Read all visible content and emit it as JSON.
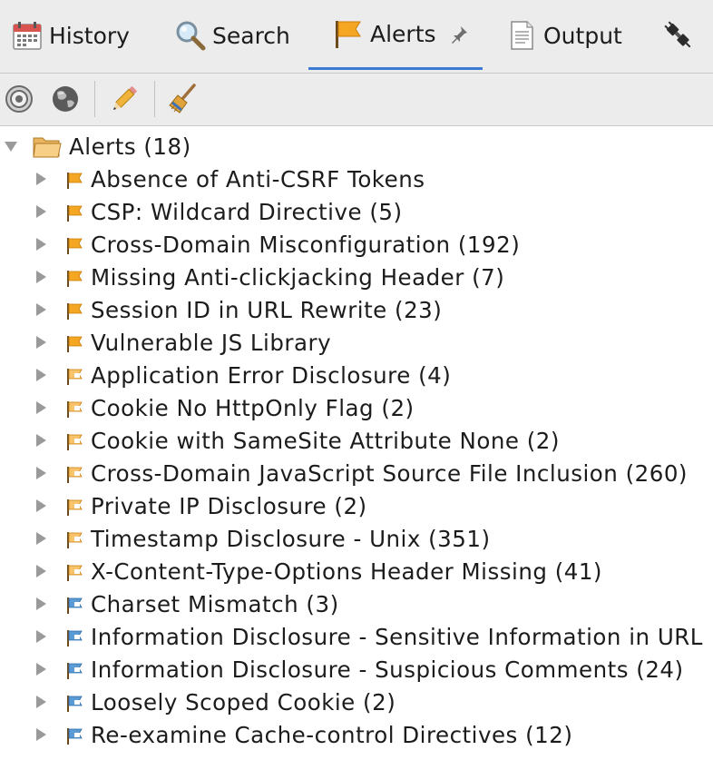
{
  "tabs": [
    {
      "label": "History",
      "icon": "calendar-icon",
      "active": false
    },
    {
      "label": "Search",
      "icon": "magnifier-icon",
      "active": false
    },
    {
      "label": "Alerts",
      "icon": "flag-icon",
      "active": true
    },
    {
      "label": "Output",
      "icon": "document-icon",
      "active": false
    }
  ],
  "extra_tab_icon": "plug-icon",
  "pin_icon": "pin-icon",
  "toolbar_icons": [
    "target-icon",
    "globe-icon",
    "pencil-icon",
    "broom-icon"
  ],
  "tree": {
    "root_label": "Alerts (18)",
    "root_icon": "folder-icon",
    "expanded": true,
    "items": [
      {
        "label": "Absence of Anti-CSRF Tokens",
        "risk": "medium"
      },
      {
        "label": "CSP: Wildcard Directive (5)",
        "risk": "medium"
      },
      {
        "label": "Cross-Domain Misconfiguration (192)",
        "risk": "medium"
      },
      {
        "label": "Missing Anti-clickjacking Header (7)",
        "risk": "medium"
      },
      {
        "label": "Session ID in URL Rewrite (23)",
        "risk": "medium"
      },
      {
        "label": "Vulnerable JS Library",
        "risk": "medium"
      },
      {
        "label": "Application Error Disclosure (4)",
        "risk": "low"
      },
      {
        "label": "Cookie No HttpOnly Flag (2)",
        "risk": "low"
      },
      {
        "label": "Cookie with SameSite Attribute None (2)",
        "risk": "low"
      },
      {
        "label": "Cross-Domain JavaScript Source File Inclusion (260)",
        "risk": "low"
      },
      {
        "label": "Private IP Disclosure (2)",
        "risk": "low"
      },
      {
        "label": "Timestamp Disclosure - Unix (351)",
        "risk": "low"
      },
      {
        "label": "X-Content-Type-Options Header Missing (41)",
        "risk": "low"
      },
      {
        "label": "Charset Mismatch  (3)",
        "risk": "informational"
      },
      {
        "label": "Information Disclosure - Sensitive Information in URL",
        "risk": "informational"
      },
      {
        "label": "Information Disclosure - Suspicious Comments (24)",
        "risk": "informational"
      },
      {
        "label": "Loosely Scoped Cookie (2)",
        "risk": "informational"
      },
      {
        "label": "Re-examine Cache-control Directives (12)",
        "risk": "informational"
      }
    ]
  },
  "colors": {
    "accent": "#3b7bd3",
    "medium_flag": "#f5a623",
    "low_flag": "#f7c46c",
    "informational_flag": "#5b9bd5"
  }
}
